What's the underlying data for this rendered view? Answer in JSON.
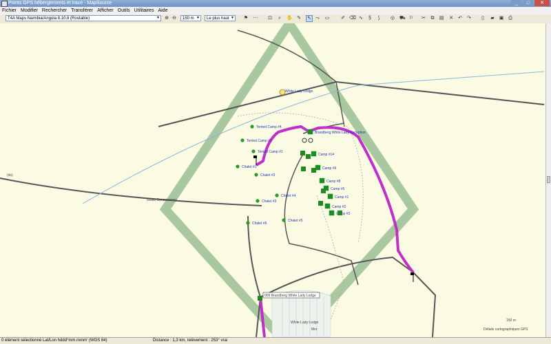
{
  "window": {
    "title": "Points GPS hébergements et tracé - MapSource",
    "btn_min": "_",
    "btn_max": "□",
    "btn_close": "✕"
  },
  "menu": [
    "Fichier",
    "Modifier",
    "Rechercher",
    "Transférer",
    "Afficher",
    "Outils",
    "Utilitaires",
    "Aide"
  ],
  "toolbar": {
    "map_product": "T4A Maps Namibia/Angola 8.10.8 (Routable)",
    "zoom_level": "150 m",
    "detail_level": "Le plus haut"
  },
  "map": {
    "waypoints": [
      {
        "label": "White Lady Lodge"
      },
      {
        "label": "Tented Camp #4"
      },
      {
        "label": "Tented Camp #3"
      },
      {
        "label": "Tented Camp #1"
      },
      {
        "label": "Chalet #1"
      },
      {
        "label": "Chalet #2"
      },
      {
        "label": "Chalet #3"
      },
      {
        "label": "Chalet #4"
      },
      {
        "label": "Chalet #5"
      },
      {
        "label": "Chalet #6"
      },
      {
        "label": "Brandberg White Lady Reception"
      },
      {
        "label": "Camp #14"
      },
      {
        "label": "Camp #9"
      },
      {
        "label": "Camp #8"
      },
      {
        "label": "Camp #5"
      },
      {
        "label": "Camp #1"
      },
      {
        "label": "Camp #2"
      },
      {
        "label": "Camp #3"
      }
    ],
    "labels": {
      "conservancy": "Tsiseb Conservancy",
      "road_left": "(ds)",
      "bottom_lodge": "White Lady Lodge",
      "bottom_mnt": "Mnt"
    },
    "selected_waypoint": "009 Brandberg White Lady Lodge",
    "scale_text": "150 m",
    "detail_text": "Détails cartographiques GPS"
  },
  "status": {
    "selection": "0 élément sélectionné",
    "coords_format": "Lat/Lon hddd°mm.mmm' (WGS 84)",
    "distance": "Distance : 1,3 km, relèvement : 253° vrai"
  },
  "colors": {
    "track": "#c030c8",
    "zone": "#aac8a0",
    "map_bg": "#fbfbe3",
    "water": "#8ab4e0"
  }
}
